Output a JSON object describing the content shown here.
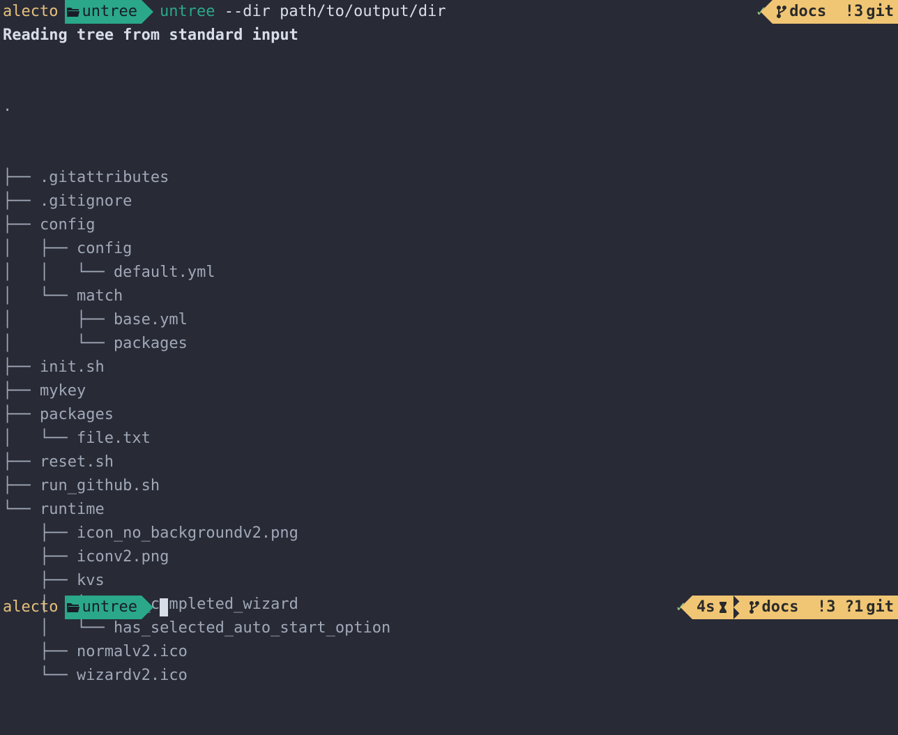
{
  "prompt": {
    "user": "alecto",
    "folder": "untree",
    "command": "untree",
    "args": "--dir path/to/output/dir"
  },
  "reading": "Reading tree from standard input",
  "tree_root": ".",
  "tree_lines": [
    "├── .gitattributes",
    "├── .gitignore",
    "├── config",
    "│   ├── config",
    "│   │   └── default.yml",
    "│   └── match",
    "│       ├── base.yml",
    "│       └── packages",
    "├── init.sh",
    "├── mykey",
    "├── packages",
    "│   └── file.txt",
    "├── reset.sh",
    "├── run_github.sh",
    "└── runtime",
    "    ├── icon_no_backgroundv2.png",
    "    ├── iconv2.png",
    "    ├── kvs",
    "    │   ├── has_completed_wizard",
    "    │   └── has_selected_auto_start_option",
    "    ├── normalv2.ico",
    "    └── wizardv2.ico"
  ],
  "status_top": {
    "check": "✓",
    "branch": "docs",
    "modified": "!3",
    "git": "git"
  },
  "status_bottom": {
    "check": "✓",
    "time": "4s",
    "branch": "docs",
    "modified": "!3",
    "untracked": "?1",
    "git": "git"
  }
}
